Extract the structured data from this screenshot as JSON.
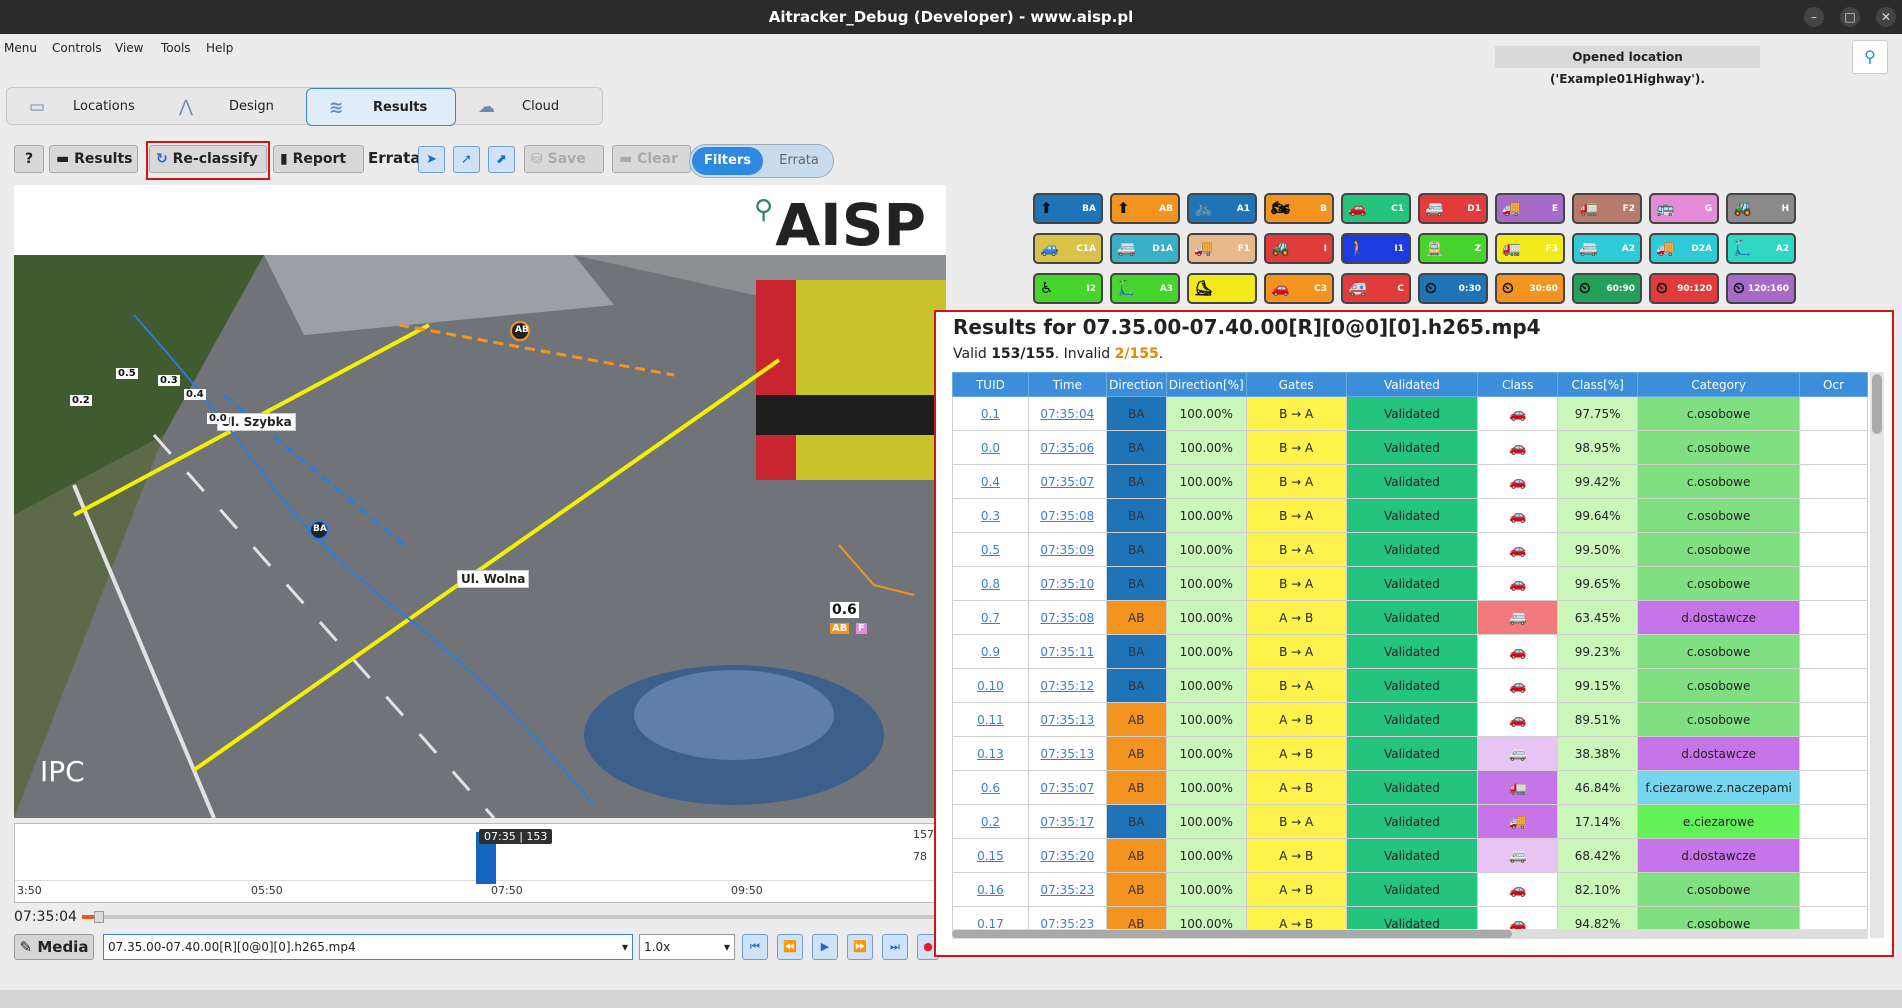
{
  "window": {
    "title": "Aitracker_Debug (Developer) - www.aisp.pl",
    "minimize_icon": "minimize-icon",
    "maximize_icon": "maximize-icon",
    "close_icon": "close-icon"
  },
  "menu": {
    "items": [
      "Menu",
      "Controls",
      "View",
      "Tools",
      "Help"
    ]
  },
  "status_message": "Opened location ('Example01Highway').",
  "main_tabs": [
    {
      "label": "Locations",
      "icon": "folder-icon"
    },
    {
      "label": "Design",
      "icon": "road-icon"
    },
    {
      "label": "Results",
      "icon": "chart-icon",
      "active": true
    },
    {
      "label": "Cloud",
      "icon": "cloud-icon"
    }
  ],
  "toolbar": {
    "help_label": "?",
    "results_label": "Results",
    "reclassify_label": "Re-classify",
    "report_label": "Report",
    "errata_label": "Errata",
    "save_label": "Save",
    "clear_label": "Clear",
    "filters_label": "Filters",
    "errata_toggle_label": "Errata"
  },
  "video": {
    "logo_text": "AISP",
    "corner_text": "IPC",
    "street_labels": [
      "Ul. Szybka",
      "Ul. Wolna"
    ],
    "track_labels": [
      "0.2",
      "0.5",
      "0.3",
      "0.4",
      "0.0",
      "0.6"
    ],
    "marker_labels": [
      "AB",
      "BA"
    ],
    "badge_ab": "AB",
    "badge_f": "F"
  },
  "timeline": {
    "bubble": "07:35 | 153",
    "ticks": [
      "3:50",
      "05:50",
      "07:50",
      "09:50"
    ],
    "y_max": "157",
    "y_mid": "78",
    "current_time": "07:35:04",
    "playback_fraction": 0.02
  },
  "media": {
    "media_label": "Media",
    "file": "07.35.00-07.40.00[R][0@0][0].h265.mp4",
    "speed": "1.0x"
  },
  "class_buttons": [
    {
      "label": "BA",
      "color": "#1f74b8",
      "icon": "arrow-up-icon"
    },
    {
      "label": "AB",
      "color": "#f39421",
      "icon": "arrow-up-icon"
    },
    {
      "label": "A1",
      "color": "#1f74b8",
      "icon": "bicycle-icon"
    },
    {
      "label": "B",
      "color": "#f39421",
      "icon": "motorcycle-icon"
    },
    {
      "label": "C1",
      "color": "#25c47e",
      "icon": "car-icon"
    },
    {
      "label": "D1",
      "color": "#e23b3b",
      "icon": "van-icon"
    },
    {
      "label": "E",
      "color": "#a66ac8",
      "icon": "truck-icon"
    },
    {
      "label": "F2",
      "color": "#b87a6a",
      "icon": "truck-trailer-icon"
    },
    {
      "label": "G",
      "color": "#e58ad6",
      "icon": "bus-icon"
    },
    {
      "label": "H",
      "color": "#8a8a8a",
      "icon": "tractor-icon"
    },
    {
      "label": "C1A",
      "color": "#d8c24a",
      "icon": "car-trailer-icon"
    },
    {
      "label": "D1A",
      "color": "#3ab0c8",
      "icon": "van-trailer-icon"
    },
    {
      "label": "F1",
      "color": "#e6b88a",
      "icon": "truck-icon"
    },
    {
      "label": "I",
      "color": "#e23b3b",
      "icon": "tractor-icon"
    },
    {
      "label": "I1",
      "color": "#1a3ce0",
      "icon": "pedestrian-icon"
    },
    {
      "label": "Z",
      "color": "#46d42d",
      "icon": "tram-icon"
    },
    {
      "label": "F3",
      "color": "#f2ea1a",
      "icon": "truck-trailer-icon"
    },
    {
      "label": "A2",
      "color": "#2fcad8",
      "icon": "van-icon"
    },
    {
      "label": "D2A",
      "color": "#2fcad8",
      "icon": "truck-icon"
    },
    {
      "label": "A2",
      "color": "#2fd8c4",
      "icon": "scooter-icon"
    },
    {
      "label": "I2",
      "color": "#46d42d",
      "icon": "wheelchair-icon"
    },
    {
      "label": "A3",
      "color": "#46d42d",
      "icon": "scooter-icon"
    },
    {
      "label": "",
      "color": "#f2ea1a",
      "icon": "rollerskate-icon"
    },
    {
      "label": "C3",
      "color": "#f39421",
      "icon": "car-icon"
    },
    {
      "label": "C",
      "color": "#e23b3b",
      "icon": "ambulance-icon"
    },
    {
      "label": "0:30",
      "color": "#1f74b8",
      "icon": "speedometer-icon"
    },
    {
      "label": "30:60",
      "color": "#f39421",
      "icon": "speedometer-icon"
    },
    {
      "label": "60:90",
      "color": "#25a05a",
      "icon": "speedometer-icon"
    },
    {
      "label": "90:120",
      "color": "#e23b3b",
      "icon": "speedometer-icon"
    },
    {
      "label": "120:160",
      "color": "#a66ac8",
      "icon": "speedometer-icon"
    }
  ],
  "results": {
    "title": "Results for 07.35.00-07.40.00[R][0@0][0].h265.mp4",
    "valid_prefix": "Valid ",
    "valid_count": "153/155",
    "invalid_prefix": ". Invalid ",
    "invalid_count": "2/155",
    "invalid_suffix": ".",
    "columns": [
      "TUID",
      "Time",
      "Direction",
      "Direction[%]",
      "Gates",
      "Validated",
      "Class",
      "Class[%]",
      "Category",
      "Ocr"
    ],
    "rows": [
      {
        "tuid": "0.1",
        "time": "07:35:04",
        "direction": "BA",
        "dir_pct": "100.00%",
        "gates": "B → A",
        "validated": "Validated",
        "class_icon": "car-icon",
        "class_pct": "97.75%",
        "category": "c.osobowe"
      },
      {
        "tuid": "0.0",
        "time": "07:35:06",
        "direction": "BA",
        "dir_pct": "100.00%",
        "gates": "B → A",
        "validated": "Validated",
        "class_icon": "car-icon",
        "class_pct": "98.95%",
        "category": "c.osobowe"
      },
      {
        "tuid": "0.4",
        "time": "07:35:07",
        "direction": "BA",
        "dir_pct": "100.00%",
        "gates": "B → A",
        "validated": "Validated",
        "class_icon": "car-icon",
        "class_pct": "99.42%",
        "category": "c.osobowe"
      },
      {
        "tuid": "0.3",
        "time": "07:35:08",
        "direction": "BA",
        "dir_pct": "100.00%",
        "gates": "B → A",
        "validated": "Validated",
        "class_icon": "car-icon",
        "class_pct": "99.64%",
        "category": "c.osobowe"
      },
      {
        "tuid": "0.5",
        "time": "07:35:09",
        "direction": "BA",
        "dir_pct": "100.00%",
        "gates": "B → A",
        "validated": "Validated",
        "class_icon": "car-icon",
        "class_pct": "99.50%",
        "category": "c.osobowe"
      },
      {
        "tuid": "0.8",
        "time": "07:35:10",
        "direction": "BA",
        "dir_pct": "100.00%",
        "gates": "B → A",
        "validated": "Validated",
        "class_icon": "car-icon",
        "class_pct": "99.65%",
        "category": "c.osobowe"
      },
      {
        "tuid": "0.7",
        "time": "07:35:08",
        "direction": "AB",
        "dir_pct": "100.00%",
        "gates": "A → B",
        "validated": "Validated",
        "class_icon": "van-icon",
        "class_pct": "63.45%",
        "category": "d.dostawcze"
      },
      {
        "tuid": "0.9",
        "time": "07:35:11",
        "direction": "BA",
        "dir_pct": "100.00%",
        "gates": "B → A",
        "validated": "Validated",
        "class_icon": "car-icon",
        "class_pct": "99.23%",
        "category": "c.osobowe"
      },
      {
        "tuid": "0.10",
        "time": "07:35:12",
        "direction": "BA",
        "dir_pct": "100.00%",
        "gates": "B → A",
        "validated": "Validated",
        "class_icon": "car-icon",
        "class_pct": "99.15%",
        "category": "c.osobowe"
      },
      {
        "tuid": "0.11",
        "time": "07:35:13",
        "direction": "AB",
        "dir_pct": "100.00%",
        "gates": "A → B",
        "validated": "Validated",
        "class_icon": "car-icon",
        "class_pct": "89.51%",
        "category": "c.osobowe"
      },
      {
        "tuid": "0.13",
        "time": "07:35:13",
        "direction": "AB",
        "dir_pct": "100.00%",
        "gates": "A → B",
        "validated": "Validated",
        "class_icon": "van-icon",
        "class_pct": "38.38%",
        "category": "d.dostawcze"
      },
      {
        "tuid": "0.6",
        "time": "07:35:07",
        "direction": "AB",
        "dir_pct": "100.00%",
        "gates": "A → B",
        "validated": "Validated",
        "class_icon": "truck-trailer-icon",
        "class_pct": "46.84%",
        "category": "f.ciezarowe.z.naczepami"
      },
      {
        "tuid": "0.2",
        "time": "07:35:17",
        "direction": "BA",
        "dir_pct": "100.00%",
        "gates": "B → A",
        "validated": "Validated",
        "class_icon": "truck-icon",
        "class_pct": "17.14%",
        "category": "e.ciezarowe"
      },
      {
        "tuid": "0.15",
        "time": "07:35:20",
        "direction": "AB",
        "dir_pct": "100.00%",
        "gates": "A → B",
        "validated": "Validated",
        "class_icon": "van-icon",
        "class_pct": "68.42%",
        "category": "d.dostawcze"
      },
      {
        "tuid": "0.16",
        "time": "07:35:23",
        "direction": "AB",
        "dir_pct": "100.00%",
        "gates": "A → B",
        "validated": "Validated",
        "class_icon": "car-icon",
        "class_pct": "82.10%",
        "category": "c.osobowe"
      },
      {
        "tuid": "0.17",
        "time": "07:35:23",
        "direction": "AB",
        "dir_pct": "100.00%",
        "gates": "A → B",
        "validated": "Validated",
        "class_icon": "car-icon",
        "class_pct": "94.82%",
        "category": "c.osobowe"
      }
    ]
  }
}
